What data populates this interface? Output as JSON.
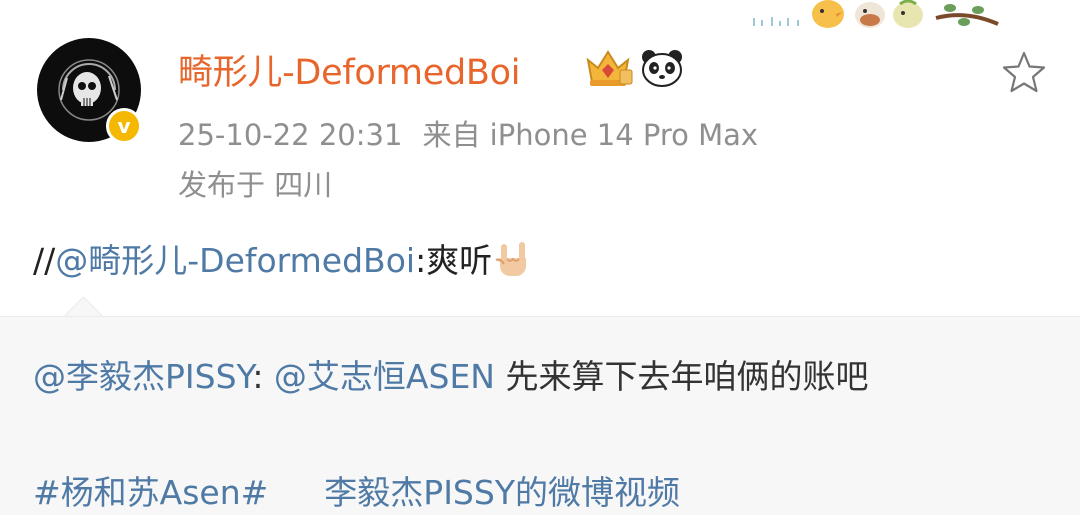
{
  "post": {
    "username": "畸形儿-DeformedBoi",
    "timestamp": "25-10-22 20:31",
    "source": "来自 iPhone 14 Pro Max",
    "location": "发布于 四川",
    "repost_prefix": "//",
    "repost_mention": "@畸形儿-DeformedBoi",
    "repost_text": ":爽听",
    "verified_mark": "v"
  },
  "quoted": {
    "author_mention": "@李毅杰PISSY",
    "colon": ": ",
    "target_mention": "@艾志恒ASEN",
    "text": " 先来算下去年咱俩的账吧",
    "hashtag": "#杨和苏Asen#",
    "video_link": "李毅杰PISSY的微博视频"
  },
  "colors": {
    "username": "#e8652b",
    "link": "#4f7aa6",
    "meta": "#8f8f8f",
    "verified": "#f5b800"
  },
  "icons": {
    "verified": "verified-badge-icon",
    "crown": "crown-badge-icon",
    "panda": "panda-icon",
    "favorite": "star-outline-icon",
    "gesture": "rock-hand-emoji-icon"
  }
}
